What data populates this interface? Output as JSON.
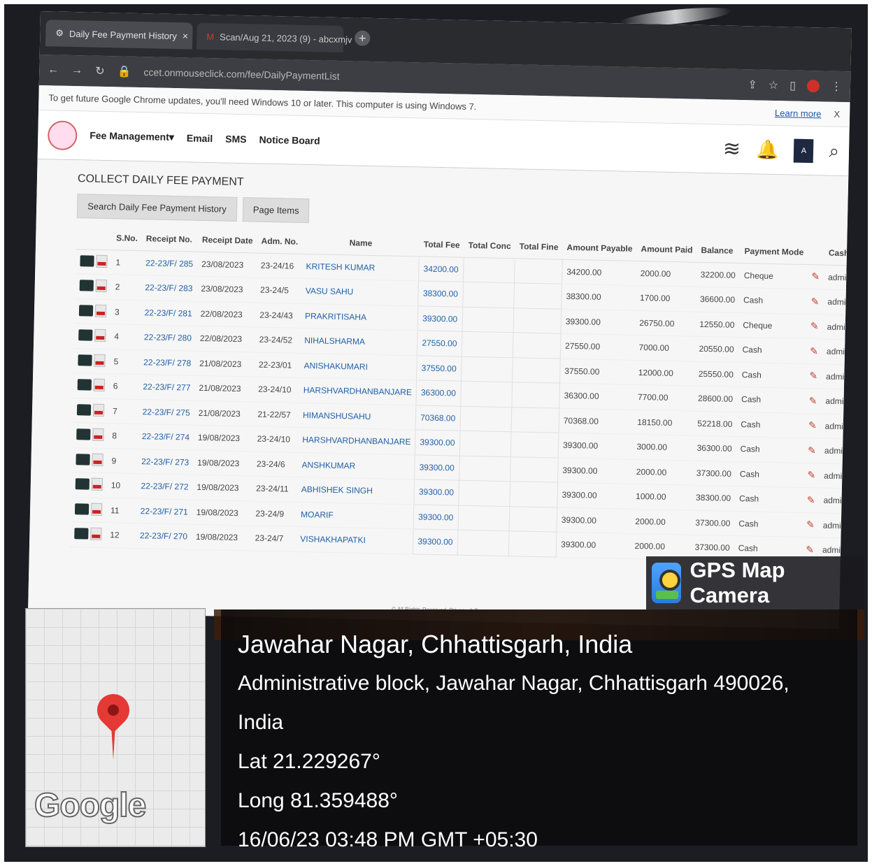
{
  "browser": {
    "tabs": [
      {
        "title": "Daily Fee Payment History"
      },
      {
        "title": "Scan/Aug 21, 2023 (9) - abcxmjv"
      }
    ],
    "url": "ccet.onmouseclick.com/fee/DailyPaymentList",
    "infobar_text": "To get future Google Chrome updates, you'll need Windows 10 or later. This computer is using Windows 7.",
    "learn_more": "Learn more",
    "close_glyph": "X"
  },
  "app": {
    "nav": [
      "Fee Management▾",
      "Email",
      "SMS",
      "Notice Board"
    ],
    "avatar_letter": "A",
    "page_title": "COLLECT DAILY FEE PAYMENT",
    "buttons": {
      "search_history": "Search Daily Fee Payment History",
      "page_items": "Page Items"
    }
  },
  "table": {
    "headers": [
      "",
      "S.No.",
      "Receipt No.",
      "Receipt Date",
      "Adm. No.",
      "Name",
      "Total Fee",
      "Total Conc",
      "Total Fine",
      "Amount Payable",
      "Amount Paid",
      "Balance",
      "Payment Mode",
      "",
      "Cashier"
    ],
    "rows": [
      {
        "sno": "1",
        "receipt": "22-23/F/ 285",
        "date": "23/08/2023",
        "adm": "23-24/16",
        "name": "KRITESH KUMAR",
        "total": "34200.00",
        "payable": "34200.00",
        "paid": "2000.00",
        "balance": "32200.00",
        "mode": "Cheque",
        "cashier": "admin"
      },
      {
        "sno": "2",
        "receipt": "22-23/F/ 283",
        "date": "23/08/2023",
        "adm": "23-24/5",
        "name": "VASU SAHU",
        "total": "38300.00",
        "payable": "38300.00",
        "paid": "1700.00",
        "balance": "36600.00",
        "mode": "Cash",
        "cashier": "admin"
      },
      {
        "sno": "3",
        "receipt": "22-23/F/ 281",
        "date": "22/08/2023",
        "adm": "23-24/43",
        "name": "PRAKRITISAHA",
        "total": "39300.00",
        "payable": "39300.00",
        "paid": "26750.00",
        "balance": "12550.00",
        "mode": "Cheque",
        "cashier": "admin"
      },
      {
        "sno": "4",
        "receipt": "22-23/F/ 280",
        "date": "22/08/2023",
        "adm": "23-24/52",
        "name": "NIHALSHARMA",
        "total": "27550.00",
        "payable": "27550.00",
        "paid": "7000.00",
        "balance": "20550.00",
        "mode": "Cash",
        "cashier": "admin"
      },
      {
        "sno": "5",
        "receipt": "22-23/F/ 278",
        "date": "21/08/2023",
        "adm": "22-23/01",
        "name": "ANISHAKUMARI",
        "total": "37550.00",
        "payable": "37550.00",
        "paid": "12000.00",
        "balance": "25550.00",
        "mode": "Cash",
        "cashier": "admin"
      },
      {
        "sno": "6",
        "receipt": "22-23/F/ 277",
        "date": "21/08/2023",
        "adm": "23-24/10",
        "name": "HARSHVARDHANBANJARE",
        "total": "36300.00",
        "payable": "36300.00",
        "paid": "7700.00",
        "balance": "28600.00",
        "mode": "Cash",
        "cashier": "admin"
      },
      {
        "sno": "7",
        "receipt": "22-23/F/ 275",
        "date": "21/08/2023",
        "adm": "21-22/57",
        "name": "HIMANSHUSAHU",
        "total": "70368.00",
        "payable": "70368.00",
        "paid": "18150.00",
        "balance": "52218.00",
        "mode": "Cash",
        "cashier": "admin"
      },
      {
        "sno": "8",
        "receipt": "22-23/F/ 274",
        "date": "19/08/2023",
        "adm": "23-24/10",
        "name": "HARSHVARDHANBANJARE",
        "total": "39300.00",
        "payable": "39300.00",
        "paid": "3000.00",
        "balance": "36300.00",
        "mode": "Cash",
        "cashier": "admin"
      },
      {
        "sno": "9",
        "receipt": "22-23/F/ 273",
        "date": "19/08/2023",
        "adm": "23-24/6",
        "name": "ANSHKUMAR",
        "total": "39300.00",
        "payable": "39300.00",
        "paid": "2000.00",
        "balance": "37300.00",
        "mode": "Cash",
        "cashier": "admin"
      },
      {
        "sno": "10",
        "receipt": "22-23/F/ 272",
        "date": "19/08/2023",
        "adm": "23-24/11",
        "name": "ABHISHEK SINGH",
        "total": "39300.00",
        "payable": "39300.00",
        "paid": "1000.00",
        "balance": "38300.00",
        "mode": "Cash",
        "cashier": "admin"
      },
      {
        "sno": "11",
        "receipt": "22-23/F/ 271",
        "date": "19/08/2023",
        "adm": "23-24/9",
        "name": "MOARIF",
        "total": "39300.00",
        "payable": "39300.00",
        "paid": "2000.00",
        "balance": "37300.00",
        "mode": "Cash",
        "cashier": "admin"
      },
      {
        "sno": "12",
        "receipt": "22-23/F/ 270",
        "date": "19/08/2023",
        "adm": "23-24/7",
        "name": "VISHAKHAPATKI",
        "total": "39300.00",
        "payable": "39300.00",
        "paid": "2000.00",
        "balance": "37300.00",
        "mode": "Cash",
        "cashier": "admin"
      }
    ]
  },
  "footer_note": "© All Rights Reserved. Privacy & Terms",
  "overlay": {
    "brand": "GPS Map Camera",
    "place": "Jawahar Nagar, Chhattisgarh, India",
    "address": "Administrative block, Jawahar Nagar, Chhattisgarh 490026, India",
    "lat": "Lat 21.229267°",
    "long": "Long 81.359488°",
    "timestamp": "16/06/23 03:48 PM GMT +05:30",
    "map_watermark": "Google"
  },
  "icons": [
    "back-icon",
    "forward-icon",
    "reload-icon",
    "lock-icon",
    "share-icon",
    "star-icon",
    "menu-icon",
    "bell-icon",
    "search-icon",
    "printer-icon",
    "pdf-icon",
    "edit-icon",
    "map-pin-icon"
  ]
}
